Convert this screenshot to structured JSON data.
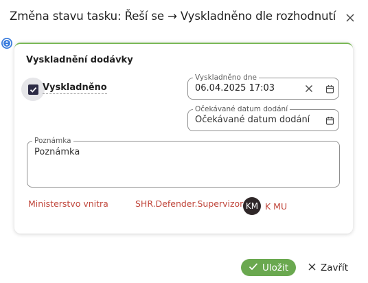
{
  "dialog": {
    "title": "Změna stavu tasku: Řeší se → Vyskladněno dle rozhodnutí",
    "close_icon": "close-icon",
    "drag_icon": "move-handle-icon"
  },
  "section": {
    "title": "Vyskladnění dodávky",
    "checkbox": {
      "label": "Vyskladněno",
      "checked": true
    }
  },
  "fields": {
    "shipped_date": {
      "legend": "Vyskladněno dne",
      "value": "06.04.2025 17:03"
    },
    "expected_date": {
      "legend": "Očekávané datum dodání",
      "placeholder": "Očekávané datum dodání"
    },
    "note": {
      "legend": "Poznámka",
      "placeholder": "Poznámka"
    }
  },
  "meta": {
    "organization": "Ministerstvo vnitra",
    "role": "SHR.Defender.Supervizor",
    "avatar_initials": "KM",
    "user": "K MU"
  },
  "actions": {
    "save_label": "Uložit",
    "close_label": "Zavřít"
  },
  "colors": {
    "accent_green": "#6aa84f",
    "link_red": "#c0463b",
    "checkbox_dark": "#2c2b45"
  }
}
